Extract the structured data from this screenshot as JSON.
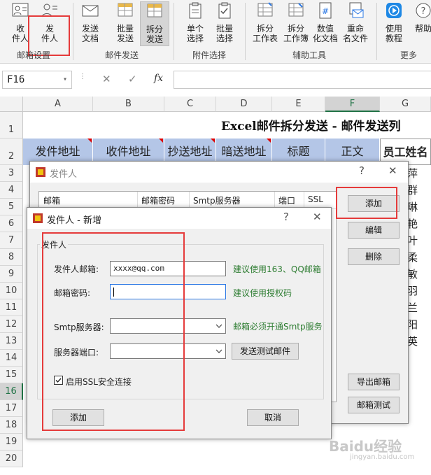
{
  "ribbon": {
    "buttons": [
      {
        "l1": "收",
        "l2": "件人"
      },
      {
        "l1": "发",
        "l2": "件人"
      },
      {
        "l1": "发送",
        "l2": "文档"
      },
      {
        "l1": "批量",
        "l2": "发送"
      },
      {
        "l1": "拆分",
        "l2": "发送"
      },
      {
        "l1": "单个",
        "l2": "选择"
      },
      {
        "l1": "批量",
        "l2": "选择"
      },
      {
        "l1": "拆分",
        "l2": "工作表"
      },
      {
        "l1": "拆分",
        "l2": "工作簿"
      },
      {
        "l1": "数值",
        "l2": "化文档"
      },
      {
        "l1": "重命",
        "l2": "名文件"
      },
      {
        "l1": "使用",
        "l2": "教程"
      },
      {
        "l1": "帮助",
        "l2": ""
      }
    ],
    "groups": {
      "g1": "邮箱设置",
      "g2": "邮件发送",
      "g3": "附件选择",
      "g4": "辅助工具",
      "g5": "更多"
    }
  },
  "formula_bar": {
    "cell_ref": "F16",
    "cancel": "✕",
    "confirm": "✓",
    "fx": "fx"
  },
  "sheet": {
    "columns": [
      "A",
      "B",
      "C",
      "D",
      "E",
      "F",
      "G"
    ],
    "rows": [
      "1",
      "2",
      "3",
      "4",
      "5",
      "6",
      "7",
      "8",
      "9",
      "10",
      "11",
      "12",
      "13",
      "14",
      "15",
      "16",
      "17",
      "18",
      "19",
      "20"
    ],
    "title": "Excel邮件拆分发送 - 邮件发送列",
    "headers": [
      "发件地址",
      "收件地址",
      "抄送地址",
      "暗送地址",
      "标题",
      "正文",
      "员工姓名"
    ],
    "names": [
      "",
      "萍",
      "群",
      "琳",
      "艳",
      "叶",
      "柔",
      "敏",
      "羽",
      "兰",
      "阳",
      "英"
    ]
  },
  "sender_dialog": {
    "title": "发件人",
    "help": "?",
    "close": "✕",
    "table_headers": [
      "邮箱",
      "邮箱密码",
      "Smtp服务器",
      "端口",
      "SSL"
    ],
    "buttons": {
      "add": "添加",
      "edit": "编辑",
      "delete": "删除",
      "export": "导出邮箱",
      "test": "邮箱测试"
    }
  },
  "add_dialog": {
    "title": "发件人 - 新增",
    "help": "?",
    "close": "✕",
    "group_label": "发件人",
    "email_label": "发件人邮箱:",
    "email_value": "xxxx@qq.com",
    "email_hint": "建议使用163、QQ邮箱",
    "password_label": "邮箱密码:",
    "password_value": "",
    "password_hint": "建议使用授权码",
    "smtp_label": "Smtp服务器:",
    "smtp_value": "",
    "smtp_hint": "邮箱必须开通Smtp服务",
    "port_label": "服务器端口:",
    "port_value": "",
    "send_test_label": "发送测试邮件",
    "ssl_label": "启用SSL安全连接",
    "ssl_checked": true,
    "add_label": "添加",
    "cancel_label": "取消"
  },
  "watermark": {
    "text": "Baidu经验",
    "url": "jingyan.baidu.com"
  }
}
